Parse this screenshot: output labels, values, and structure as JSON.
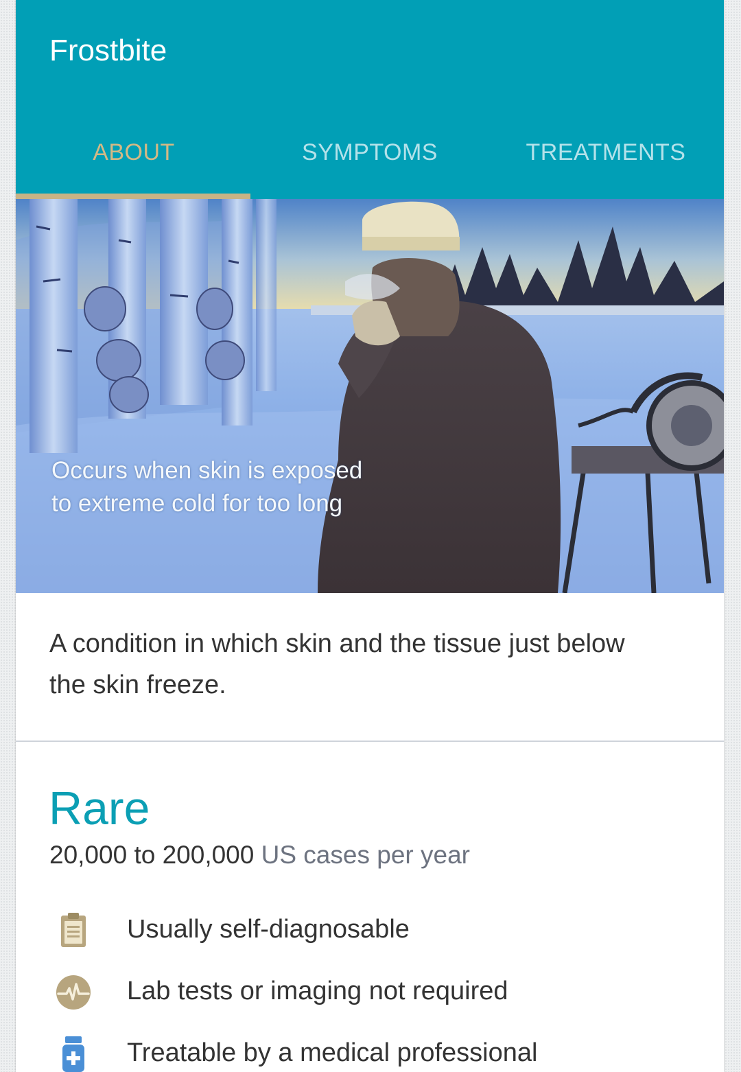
{
  "header": {
    "title": "Frostbite",
    "tabs": [
      {
        "label": "ABOUT",
        "active": true
      },
      {
        "label": "SYMPTOMS",
        "active": false
      },
      {
        "label": "TREATMENTS",
        "active": false
      }
    ]
  },
  "hero": {
    "caption": "Occurs when skin is exposed to extreme cold for too long"
  },
  "description": "A condition in which skin and the tissue just below the skin freeze.",
  "prevalence": {
    "rarity": "Rare",
    "count": "20,000 to 200,000",
    "unit": "US cases per year"
  },
  "facts": [
    {
      "icon": "clipboard-icon",
      "label": "Usually self-diagnosable"
    },
    {
      "icon": "heartbeat-icon",
      "label": "Lab tests or imaging not required"
    },
    {
      "icon": "medicine-bottle-icon",
      "label": "Treatable by a medical professional"
    }
  ],
  "colors": {
    "appbar": "#019fb6",
    "tab_active": "#d3b985",
    "tab_inactive": "#b4e2ea",
    "rarity": "#0b9fb4",
    "icon_tan": "#b7a57e",
    "icon_blue": "#4a8fd6"
  }
}
